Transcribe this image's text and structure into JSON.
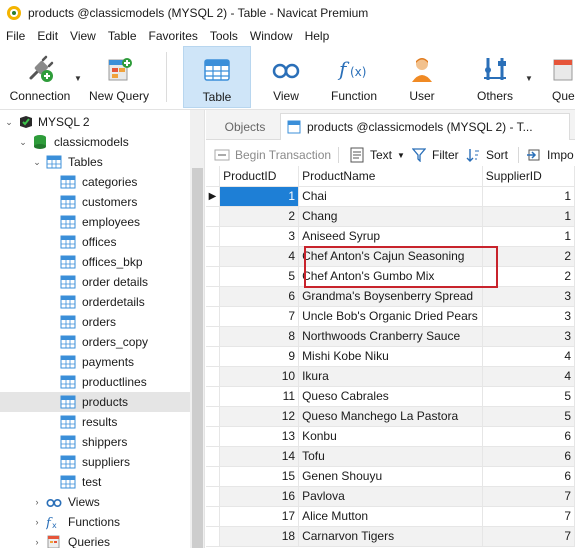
{
  "window": {
    "title": "products @classicmodels (MYSQL 2) - Table - Navicat Premium"
  },
  "menu": [
    "File",
    "Edit",
    "View",
    "Table",
    "Favorites",
    "Tools",
    "Window",
    "Help"
  ],
  "toolbar": {
    "connection": "Connection",
    "new_query": "New Query",
    "table": "Table",
    "view": "View",
    "function": "Function",
    "user": "User",
    "others": "Others",
    "query_partial": "Que"
  },
  "sidebar": {
    "connection": "MYSQL 2",
    "database": "classicmodels",
    "tables_group": "Tables",
    "tables": [
      "categories",
      "customers",
      "employees",
      "offices",
      "offices_bkp",
      "order details",
      "orderdetails",
      "orders",
      "orders_copy",
      "payments",
      "productlines",
      "products",
      "results",
      "shippers",
      "suppliers",
      "test"
    ],
    "selected_table": "products",
    "views_group": "Views",
    "functions_group": "Functions",
    "queries_group": "Queries"
  },
  "tabs": {
    "objects": "Objects",
    "active": "products @classicmodels (MYSQL 2) - T..."
  },
  "subtoolbar": {
    "begin_transaction": "Begin Transaction",
    "text": "Text",
    "filter": "Filter",
    "sort": "Sort",
    "import_partial": "Impo"
  },
  "grid": {
    "columns": [
      "ProductID",
      "ProductName",
      "SupplierID"
    ],
    "rows": [
      [
        "1",
        "Chai",
        "1"
      ],
      [
        "2",
        "Chang",
        "1"
      ],
      [
        "3",
        "Aniseed Syrup",
        "1"
      ],
      [
        "4",
        "Chef Anton's Cajun Seasoning",
        "2"
      ],
      [
        "5",
        "Chef Anton's Gumbo Mix",
        "2"
      ],
      [
        "6",
        "Grandma's Boysenberry Spread",
        "3"
      ],
      [
        "7",
        "Uncle Bob's Organic Dried Pears",
        "3"
      ],
      [
        "8",
        "Northwoods Cranberry Sauce",
        "3"
      ],
      [
        "9",
        "Mishi Kobe Niku",
        "4"
      ],
      [
        "10",
        "Ikura",
        "4"
      ],
      [
        "11",
        "Queso Cabrales",
        "5"
      ],
      [
        "12",
        "Queso Manchego La Pastora",
        "5"
      ],
      [
        "13",
        "Konbu",
        "6"
      ],
      [
        "14",
        "Tofu",
        "6"
      ],
      [
        "15",
        "Genen Shouyu",
        "6"
      ],
      [
        "16",
        "Pavlova",
        "7"
      ],
      [
        "17",
        "Alice Mutton",
        "7"
      ],
      [
        "18",
        "Carnarvon Tigers",
        "7"
      ]
    ],
    "current_row": 0,
    "highlighted_rows": [
      3,
      4
    ]
  },
  "colors": {
    "accent": "#1e7fd6",
    "highlight_box": "#c8232c",
    "selection_bg": "#cfe5f8"
  }
}
